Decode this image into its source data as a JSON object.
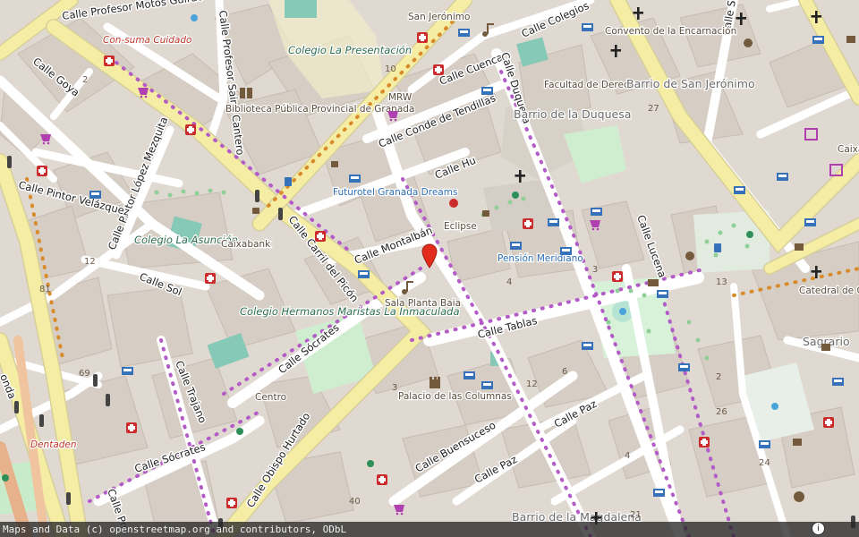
{
  "map": {
    "attribution": "Maps and Data (c) openstreetmap.org and contributors, ODbL",
    "info_button": "i",
    "marker_icon": "map-pin-icon",
    "colors": {
      "background": "#e0d9d2",
      "building": "#d6cec4",
      "main_road": "#f5eda4",
      "park": "#c8ebc9",
      "water_feature": "#86c9b6",
      "marker": "#e32b1c"
    }
  },
  "streets": [
    "Calle Profesor Motos Guirao",
    "Calle Profesor Sainz Cantero",
    "Calle Goya",
    "Calle Pintor López Mezquita",
    "Calle Pintor Velázquez",
    "Calle Sol",
    "Calle Carril del Picón",
    "Calle Montalbán",
    "Calle Conde de Tendillas",
    "Calle Cuenca",
    "Calle Duquesa",
    "Calle Colegios",
    "Calle Hu",
    "Calle Sócrates",
    "Calle Sócrates",
    "Calle Trajano",
    "Calle Tablas",
    "Calle Obispo Hurtado",
    "Calle Buensuceso",
    "Calle Paz",
    "Calle Paz",
    "Calle Lucena",
    "Calle S",
    "Calle Pro",
    "onda"
  ],
  "places": {
    "con_sum_cuidado": "Con-suma Cuidado",
    "colegio_presentacion": "Colegio La Presentación",
    "san_jeronimo": "San Jerónimo",
    "biblioteca": "Biblioteca Pública Provincial de Granada",
    "facultad": "Facultad de Derecho",
    "barrio_duquesa": "Barrio de la Duquesa",
    "convento": "Convento de la Encarnación",
    "barrio_san_jeronimo": "Barrio de San Jerónimo",
    "futurotel": "Futurotel Granada Dreams",
    "colegio_asuncion": "Colegio La Asunción",
    "caixabank": "Caixabank",
    "eclipse": "Eclipse",
    "pension": "Pensión Meridiano",
    "sala_planta": "Sala Planta Baja",
    "colegio_maristas": "Colegio Hermanos Maristas La Inmaculada",
    "centro": "Centro",
    "palacio": "Palacio de las Columnas",
    "catedral": "Catedral de Granada",
    "sagrario": "Sagrario",
    "dentaden": "Dentaden",
    "barrio_magdalena": "Barrio de la Magdalena",
    "caixa": "Caixa",
    "mrw": "MRW"
  },
  "house_numbers": [
    "2",
    "10",
    "12",
    "81",
    "69",
    "27",
    "3",
    "4",
    "12",
    "6",
    "3",
    "26",
    "24",
    "40",
    "21",
    "4",
    "2",
    "13"
  ]
}
